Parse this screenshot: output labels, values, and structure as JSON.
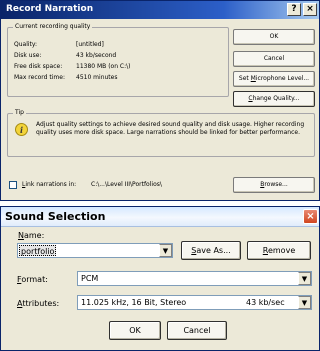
{
  "record_narration": {
    "title": "Record Narration",
    "help_glyph": "?",
    "close_glyph": "×",
    "group_quality": "Current recording quality",
    "quality_label": "Quality:",
    "quality_value": "[untitled]",
    "disk_use_label": "Disk use:",
    "disk_use_value": "43 kb/second",
    "free_space_label": "Free disk space:",
    "free_space_value": "11380 MB (on C:\\)",
    "max_time_label": "Max record time:",
    "max_time_value": "4510 minutes",
    "ok_label": "OK",
    "cancel_label": "Cancel",
    "set_mic_pre": "Set ",
    "set_mic_u": "M",
    "set_mic_post": "icrophone Level...",
    "change_quality_u": "C",
    "change_quality_post": "hange Quality...",
    "group_tip": "Tip",
    "info_glyph": "i",
    "tip_text": "Adjust quality settings to achieve desired sound quality and disk usage. Higher recording quality uses more disk space. Large narrations should be linked for better performance.",
    "link_label_u": "L",
    "link_label_post": "ink narrations in:",
    "link_path": "C:\\...\\Level III\\Portfolios\\",
    "browse_u": "B",
    "browse_post": "rowse..."
  },
  "sound_selection": {
    "title": "Sound Selection",
    "close_glyph": "×",
    "name_label_u": "N",
    "name_label_post": "ame:",
    "name_value": "portfolio",
    "dropdown_glyph": "▼",
    "save_as_u": "S",
    "save_as_post": "ave As...",
    "remove_u": "R",
    "remove_post": "emove",
    "format_label_u": "F",
    "format_label_post": "ormat:",
    "format_value": "PCM",
    "attributes_label_u": "A",
    "attributes_label_post": "ttributes:",
    "attributes_value": "11.025 kHz, 16 Bit, Stereo",
    "attributes_rate": "43 kb/sec",
    "ok_label": "OK",
    "cancel_label": "Cancel"
  }
}
